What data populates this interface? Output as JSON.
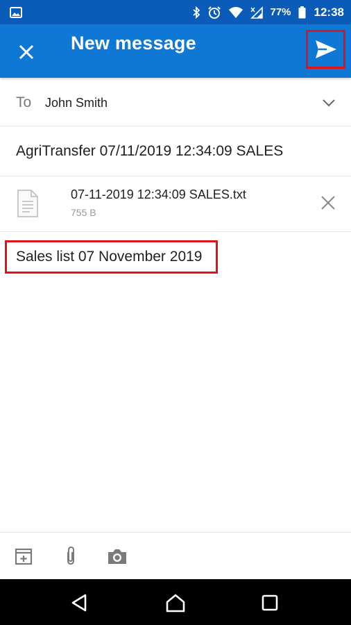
{
  "status_bar": {
    "battery_percent": "77%",
    "time": "12:38",
    "icons": [
      "image-icon",
      "bluetooth-icon",
      "alarm-icon",
      "wifi-icon",
      "signal-icon",
      "battery-icon"
    ]
  },
  "app_bar": {
    "title": "New message",
    "close_icon": "close-icon",
    "send_icon": "send-icon",
    "color": "#0f78d4"
  },
  "compose": {
    "to_label": "To",
    "recipient": "John Smith",
    "subject": "AgriTransfer 07/11/2019 12:34:09 SALES",
    "attachment": {
      "name": "07-11-2019 12:34:09 SALES.txt",
      "size": "755 B",
      "icon": "file-icon"
    },
    "body": "Sales list 07 November 2019"
  },
  "toolbar": {
    "items": [
      "calendar-add-icon",
      "attach-icon",
      "camera-icon"
    ]
  },
  "nav_bar": {
    "items": [
      "back-icon",
      "home-icon",
      "recents-icon"
    ]
  },
  "highlight_color": "#e0131a"
}
